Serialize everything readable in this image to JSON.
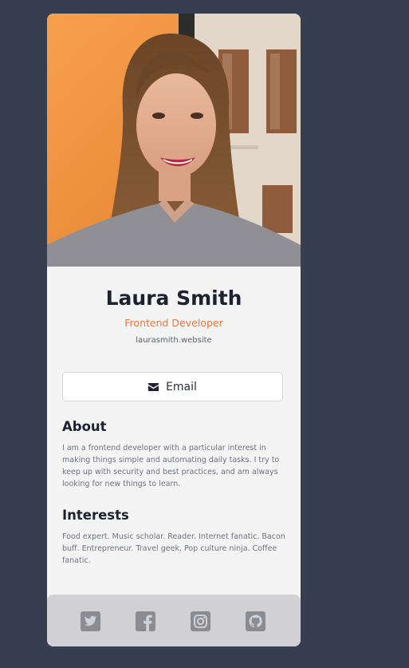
{
  "profile": {
    "name": "Laura Smith",
    "title": "Frontend Developer",
    "website": "laurasmith.website"
  },
  "actions": {
    "email_label": "Email",
    "email_icon": "envelope-icon"
  },
  "about": {
    "heading": "About",
    "text": "I am a frontend developer with a particular interest in making things simple and automating daily tasks. I try to keep up with security and best practices, and am always looking for new things to learn."
  },
  "interests": {
    "heading": "Interests",
    "text": "Food expert. Music scholar. Reader. Internet fanatic. Bacon buff. Entrepreneur. Travel geek. Pop culture ninja. Coffee fanatic."
  },
  "footer": {
    "icons": [
      "twitter-icon",
      "facebook-icon",
      "instagram-icon",
      "github-icon"
    ]
  },
  "colors": {
    "background": "#363e4f",
    "card": "#f4f4f5",
    "accent": "#e8773b",
    "footer": "#d0d0d5",
    "social_icon": "#8b8b92"
  }
}
